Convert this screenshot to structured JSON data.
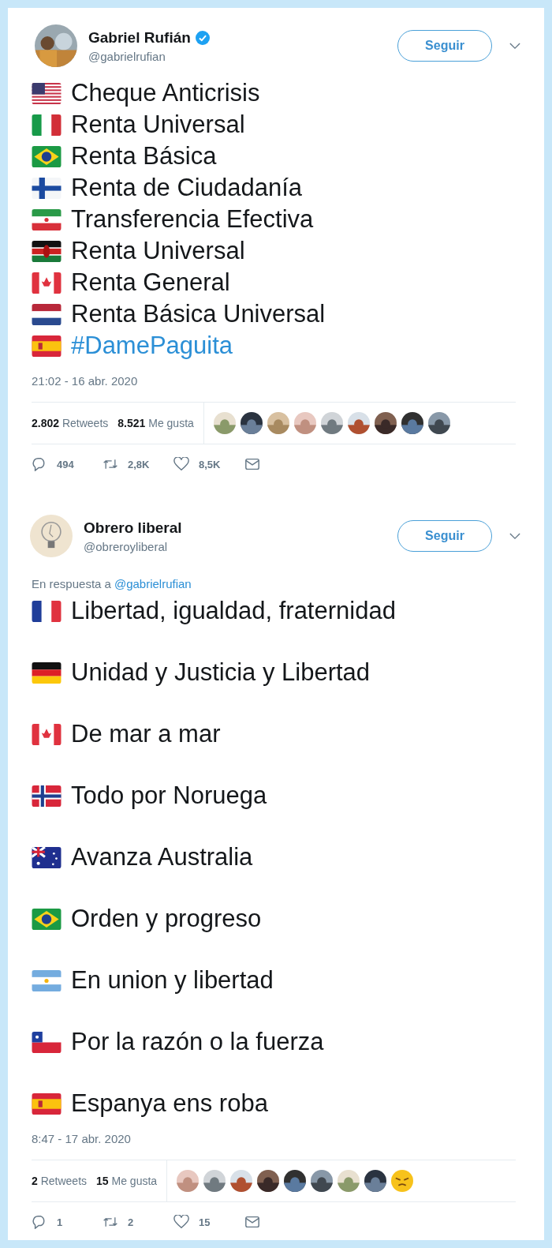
{
  "tweets": [
    {
      "author": {
        "name": "Gabriel Rufián",
        "handle": "@gabrielrufian",
        "verified": true
      },
      "follow_button": "Seguir",
      "blank_line_between": false,
      "lines": [
        {
          "kind": "us",
          "text": "Cheque Anticrisis",
          "hashtag": false
        },
        {
          "kind": "it",
          "text": "Renta Universal",
          "hashtag": false
        },
        {
          "kind": "br",
          "text": "Renta Básica",
          "hashtag": false
        },
        {
          "kind": "fi",
          "text": "Renta de Ciudadanía",
          "hashtag": false
        },
        {
          "kind": "ir",
          "text": "Transferencia Efectiva",
          "hashtag": false
        },
        {
          "kind": "ke",
          "text": "Renta Universal",
          "hashtag": false
        },
        {
          "kind": "ca",
          "text": "Renta General",
          "hashtag": false
        },
        {
          "kind": "nl",
          "text": "Renta Básica Universal",
          "hashtag": false
        },
        {
          "kind": "es",
          "text": "#DamePaguita",
          "hashtag": true
        }
      ],
      "timestamp": "21:02 - 16 abr. 2020",
      "stats": {
        "retweets": "2.802",
        "retweets_label": "Retweets",
        "likes": "8.521",
        "likes_label": "Me gusta"
      },
      "liker_avatars": [
        {
          "kind": "picture"
        },
        {
          "kind": "picture"
        },
        {
          "kind": "picture"
        },
        {
          "kind": "picture"
        },
        {
          "kind": "picture"
        },
        {
          "kind": "picture"
        },
        {
          "kind": "picture"
        },
        {
          "kind": "picture"
        },
        {
          "kind": "picture"
        }
      ],
      "actions": {
        "replies": "494",
        "retweets": "2,8K",
        "likes": "8,5K"
      }
    },
    {
      "author": {
        "name": "Obrero liberal",
        "handle": "@obreroyliberal",
        "verified": false
      },
      "follow_button": "Seguir",
      "blank_line_between": true,
      "reply_to": {
        "prefix": "En respuesta a",
        "handle": "@gabrielrufian"
      },
      "lines": [
        {
          "kind": "fr",
          "text": "Libertad, igualdad, fraternidad",
          "hashtag": false
        },
        {
          "kind": "de",
          "text": "Unidad y Justicia y Libertad",
          "hashtag": false
        },
        {
          "kind": "ca",
          "text": "De mar a mar",
          "hashtag": false
        },
        {
          "kind": "no",
          "text": "Todo por Noruega",
          "hashtag": false
        },
        {
          "kind": "au",
          "text": "Avanza Australia",
          "hashtag": false
        },
        {
          "kind": "br",
          "text": "Orden y progreso",
          "hashtag": false
        },
        {
          "kind": "ar",
          "text": "En union y libertad",
          "hashtag": false
        },
        {
          "kind": "cl",
          "text": "Por la razón o la fuerza",
          "hashtag": false
        },
        {
          "kind": "es",
          "text": "Espanya ens roba",
          "hashtag": false
        }
      ],
      "timestamp": "8:47 - 17 abr. 2020",
      "stats": {
        "retweets": "2",
        "retweets_label": "Retweets",
        "likes": "15",
        "likes_label": "Me gusta"
      },
      "liker_avatars": [
        {
          "kind": "picture"
        },
        {
          "kind": "picture"
        },
        {
          "kind": "picture"
        },
        {
          "kind": "picture"
        },
        {
          "kind": "picture"
        },
        {
          "kind": "picture"
        },
        {
          "kind": "picture"
        },
        {
          "kind": "picture"
        },
        {
          "kind": "emoji"
        }
      ],
      "actions": {
        "replies": "1",
        "retweets": "2",
        "likes": "15"
      }
    }
  ]
}
